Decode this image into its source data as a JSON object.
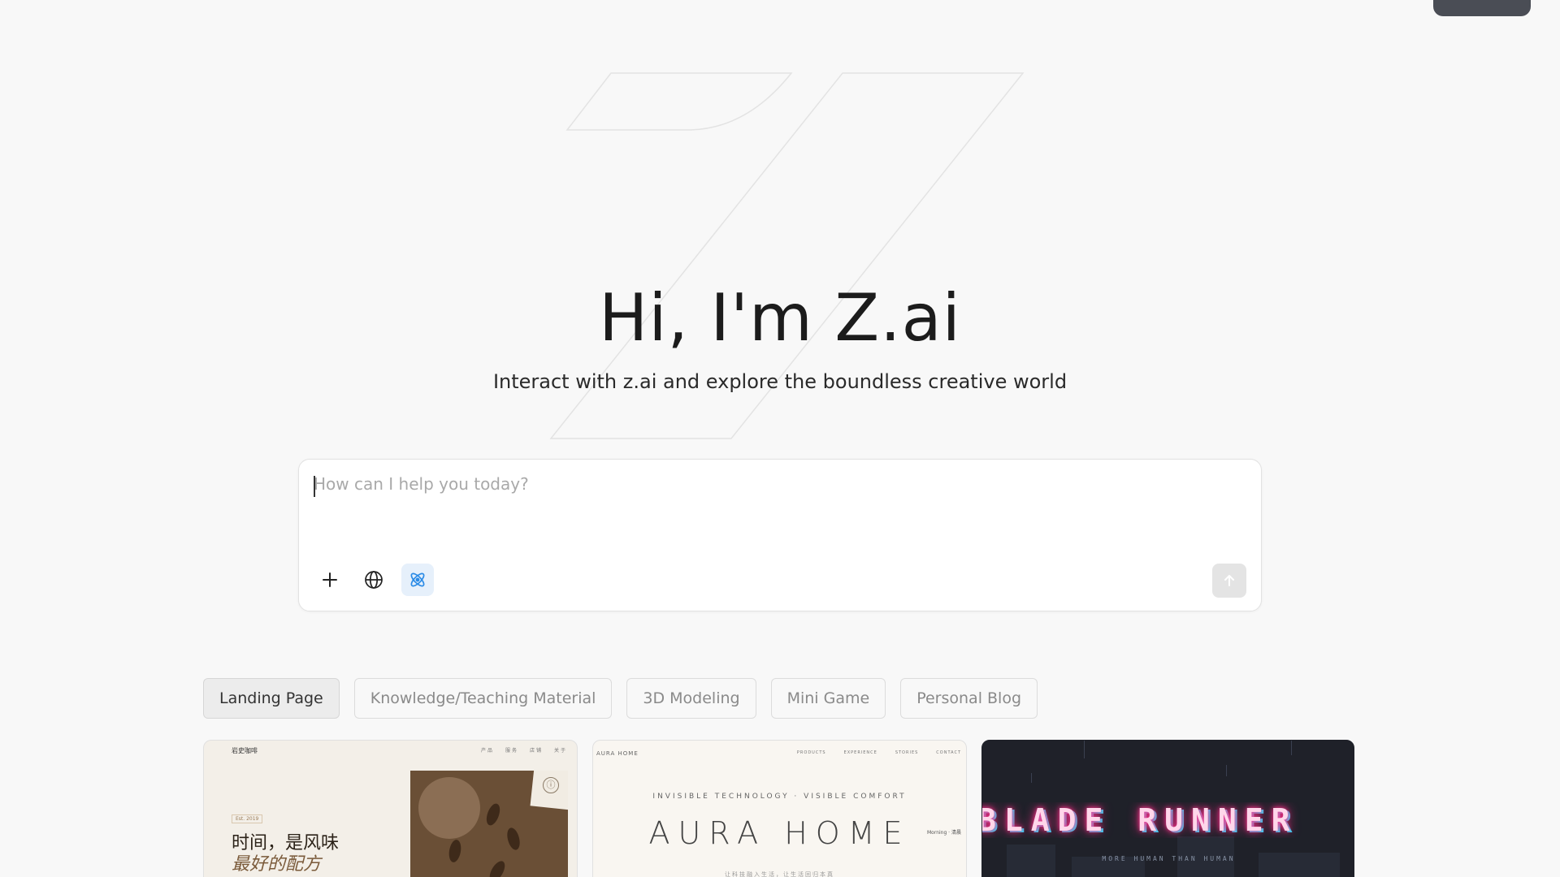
{
  "hero": {
    "title": "Hi, I'm Z.ai",
    "subtitle": "Interact with z.ai and explore the boundless creative world"
  },
  "composer": {
    "placeholder": "How can I help you today?",
    "tools": [
      {
        "icon": "plus-icon"
      },
      {
        "icon": "globe-icon"
      },
      {
        "icon": "atom-icon",
        "active": true
      }
    ],
    "send_icon": "arrow-up-icon"
  },
  "categories": {
    "selected": "Landing Page",
    "items": [
      "Landing Page",
      "Knowledge/Teaching Material",
      "3D Modeling",
      "Mini Game",
      "Personal Blog"
    ]
  },
  "showcase": {
    "card1": {
      "brand": "岩史咖啡",
      "nav": [
        "产品",
        "服务",
        "店铺",
        "关于"
      ],
      "tag": "Est. 2019",
      "headline_line1": "时间，是风味",
      "headline_line2": "最好的配方",
      "seal": "ⓘ"
    },
    "card2": {
      "brand": "AURA HOME",
      "nav": [
        "PRODUCTS",
        "EXPERIENCE",
        "STORIES",
        "CONTACT"
      ],
      "kicker": "INVISIBLE TECHNOLOGY · VISIBLE COMFORT",
      "title": "AURA HOME",
      "side_note": "Morning · 清晨",
      "footnote": "让科技融入生活，让生活回归本真"
    },
    "card3": {
      "title": "BLADE RUNNER",
      "subtitle": "MORE HUMAN THAN HUMAN"
    }
  },
  "colors": {
    "background": "#f8f8f8",
    "accent": "#2b8be6",
    "active_tool_bg": "#e6f0fb",
    "send_disabled": "#e4e4e4",
    "neon_pink": "#ff2e8a",
    "neon_cyan": "#22e6ff"
  }
}
